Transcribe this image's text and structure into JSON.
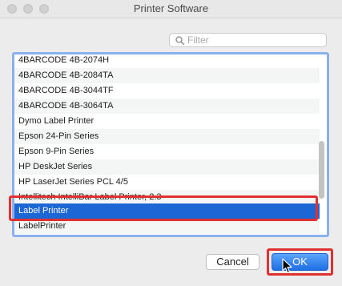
{
  "window": {
    "title": "Printer Software"
  },
  "filter": {
    "placeholder": "Filter",
    "value": ""
  },
  "list": {
    "items": [
      {
        "label": "4BARCODE 4B-2074H"
      },
      {
        "label": "4BARCODE 4B-2084TA"
      },
      {
        "label": "4BARCODE 4B-3044TF"
      },
      {
        "label": "4BARCODE 4B-3064TA"
      },
      {
        "label": "Dymo Label Printer"
      },
      {
        "label": "Epson 24-Pin Series"
      },
      {
        "label": "Epson 9-Pin Series"
      },
      {
        "label": "HP DeskJet Series"
      },
      {
        "label": "HP LaserJet Series PCL 4/5"
      },
      {
        "label": "Intellitech IntelliBar Label Printer, 2.3"
      },
      {
        "label": "Label Printer"
      },
      {
        "label": "LabelPrinter"
      }
    ],
    "selected_label": "Label Printer"
  },
  "buttons": {
    "cancel": "Cancel",
    "ok": "OK"
  },
  "colors": {
    "selection": "#1c66d6",
    "highlight": "#e03030",
    "focus_ring": "#8bb0ee"
  }
}
